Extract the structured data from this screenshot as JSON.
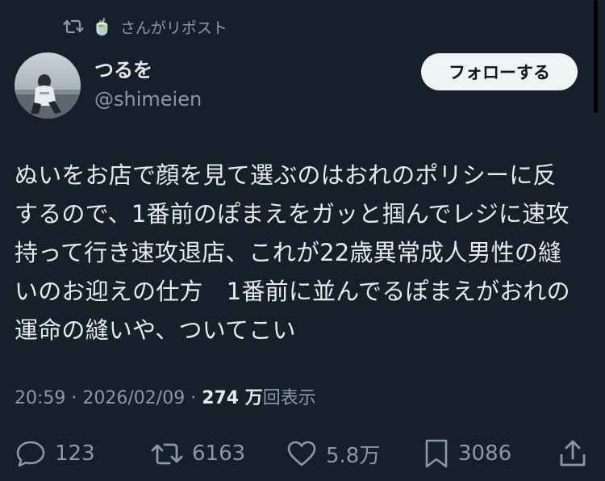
{
  "repost": {
    "icon": "repost-icon",
    "emoji": "🍵",
    "text": "さんがリポスト"
  },
  "user": {
    "display_name": "つるを",
    "handle": "@shimeien",
    "avatar": "user-avatar-photo"
  },
  "follow_button": {
    "label": "フォローする"
  },
  "post": {
    "lines": [
      "ぬいをお店で顔を見て選ぶのはおれのポリシーに反",
      "するので、1番前のぽまえをガッと掴んでレジに速攻",
      "持って行き速攻退店、これが22歳異常成人男性の縫",
      "いのお迎えの仕方　1番前に並んでるぽまえがおれの",
      "運命の縫いや、ついてこい"
    ]
  },
  "meta": {
    "time": "20:59",
    "date": "2026/02/09",
    "separator": " · ",
    "views_count": "274 万",
    "views_label": "回表示"
  },
  "actions": {
    "reply_count": "123",
    "repost_count": "6163",
    "like_count": "5.8万",
    "bookmark_count": "3086"
  },
  "colors": {
    "background": "#15202b",
    "text_primary": "#e7e9ea",
    "text_secondary": "#8b98a5",
    "button_bg": "#eff3f4"
  }
}
